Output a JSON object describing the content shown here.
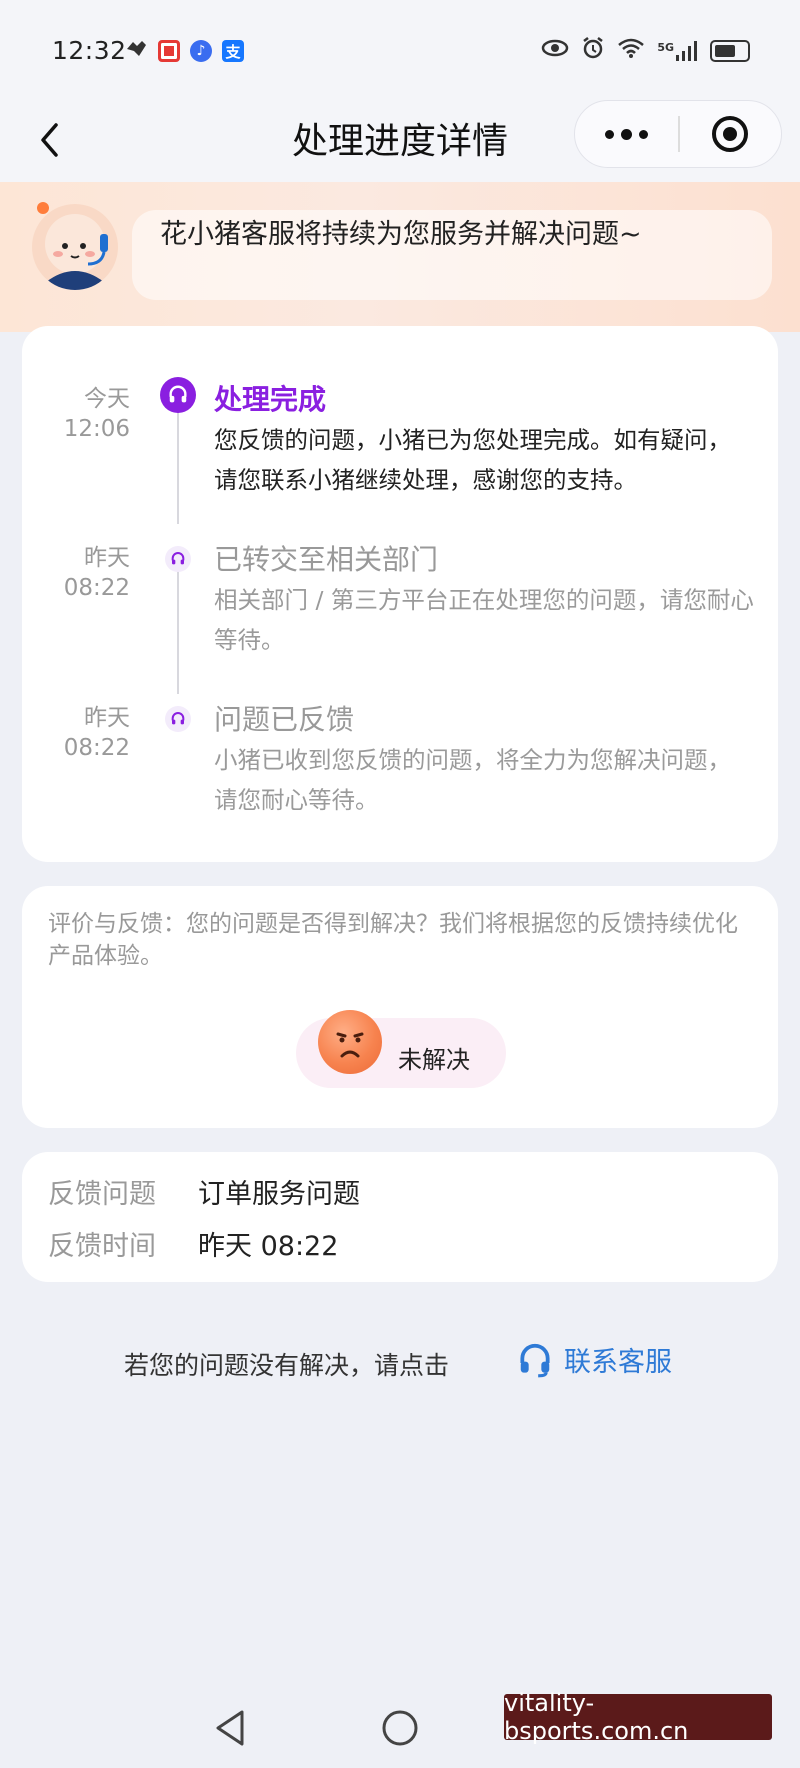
{
  "status_bar": {
    "time": "12:32",
    "left_icons": [
      "app-icon",
      "red-app-icon",
      "music-icon",
      "alipay-icon"
    ],
    "right_icons": [
      "eye-icon",
      "alarm-icon",
      "wifi-icon",
      "5g-signal-icon",
      "battery-icon"
    ],
    "network": "5G"
  },
  "nav": {
    "title": "处理进度详情"
  },
  "banner": {
    "text": "花小猪客服将持续为您服务并解决问题~"
  },
  "timeline": [
    {
      "day": "今天",
      "time": "12:06",
      "title": "处理完成",
      "desc": "您反馈的问题，小猪已为您处理完成。如有疑问，请您联系小猪继续处理，感谢您的支持。"
    },
    {
      "day": "昨天",
      "time": "08:22",
      "title": "已转交至相关部门",
      "desc": "相关部门 / 第三方平台正在处理您的问题，请您耐心等待。"
    },
    {
      "day": "昨天",
      "time": "08:22",
      "title": "问题已反馈",
      "desc": "小猪已收到您反馈的问题，将全力为您解决问题，请您耐心等待。"
    }
  ],
  "evaluation": {
    "text": "评价与反馈：您的问题是否得到解决？我们将根据您的反馈持续优化产品体验。",
    "button_label": "未解决"
  },
  "info": {
    "rows": [
      {
        "label": "反馈问题",
        "value": "订单服务问题"
      },
      {
        "label": "反馈时间",
        "value": "昨天 08:22"
      }
    ]
  },
  "footer": {
    "prompt": "若您的问题没有解决，请点击",
    "contact_label": "联系客服"
  },
  "watermark": "vitality-bsports.com.cn",
  "colors": {
    "accent_purple": "#8a1fe0",
    "link_blue": "#2e7ad6",
    "background": "#eef0f6"
  }
}
